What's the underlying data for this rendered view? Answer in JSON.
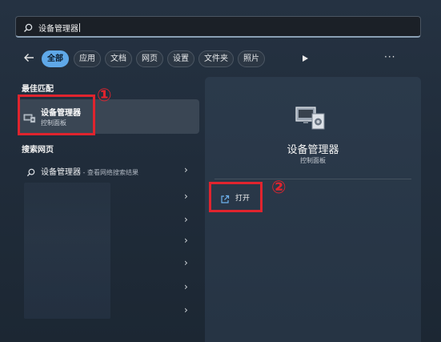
{
  "search": {
    "value": "设备管理器"
  },
  "filters": {
    "items": [
      {
        "label": "全部",
        "active": true
      },
      {
        "label": "应用",
        "active": false
      },
      {
        "label": "文档",
        "active": false
      },
      {
        "label": "网页",
        "active": false
      },
      {
        "label": "设置",
        "active": false
      },
      {
        "label": "文件夹",
        "active": false
      },
      {
        "label": "照片",
        "active": false
      }
    ],
    "more": "···"
  },
  "best_match": {
    "heading": "最佳匹配",
    "title": "设备管理器",
    "subtitle": "控制面板",
    "icon": "device-manager-icon"
  },
  "web": {
    "heading": "搜索网页",
    "query": "设备管理器",
    "suffix": " - 查看网络搜索结果"
  },
  "detail": {
    "title": "设备管理器",
    "subtitle": "控制面板",
    "open_label": "打开"
  },
  "annotations": {
    "one": "①",
    "two": "②"
  },
  "colors": {
    "accent": "#5fa8e8",
    "highlight_box": "#e0242e"
  }
}
